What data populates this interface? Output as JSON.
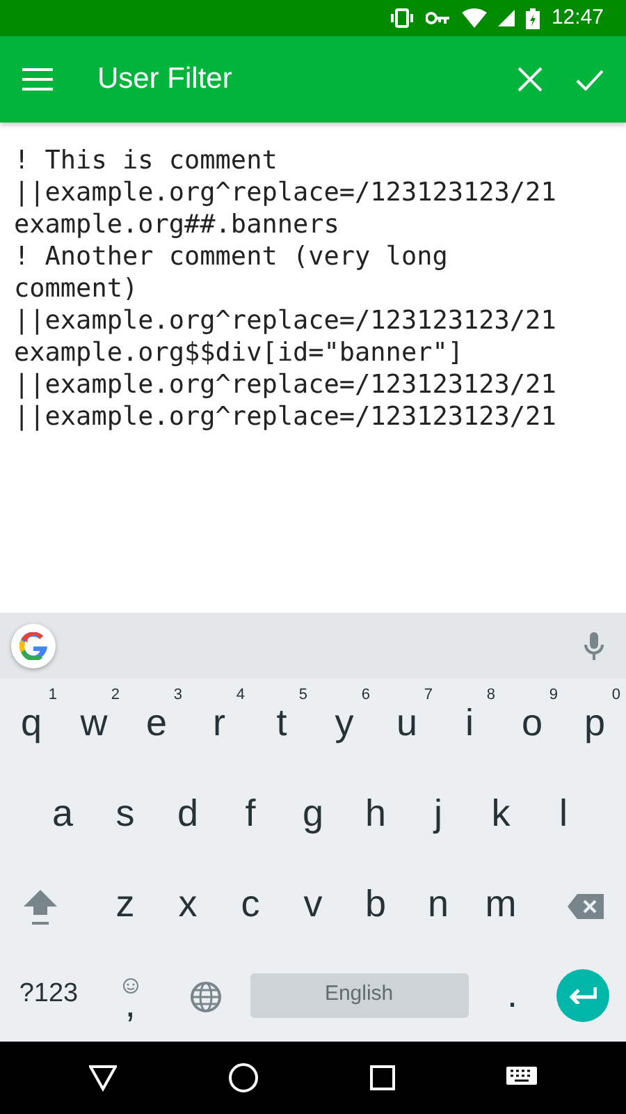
{
  "status_bar": {
    "time": "12:47"
  },
  "app_bar": {
    "title": "User Filter"
  },
  "editor": {
    "lines": [
      "! This is comment",
      "||example.org^replace=/123123123/21",
      "example.org##.banners",
      "! Another comment (very long comment)",
      "||example.org^replace=/123123123/21",
      "example.org$$div[id=\"banner\"]",
      "||example.org^replace=/123123123/21",
      "||example.org^replace=/123123123/21"
    ]
  },
  "keyboard": {
    "rows": [
      [
        {
          "label": "q",
          "hint": "1"
        },
        {
          "label": "w",
          "hint": "2"
        },
        {
          "label": "e",
          "hint": "3"
        },
        {
          "label": "r",
          "hint": "4"
        },
        {
          "label": "t",
          "hint": "5"
        },
        {
          "label": "y",
          "hint": "6"
        },
        {
          "label": "u",
          "hint": "7"
        },
        {
          "label": "i",
          "hint": "8"
        },
        {
          "label": "o",
          "hint": "9"
        },
        {
          "label": "p",
          "hint": "0"
        }
      ],
      [
        {
          "label": "a"
        },
        {
          "label": "s"
        },
        {
          "label": "d"
        },
        {
          "label": "f"
        },
        {
          "label": "g"
        },
        {
          "label": "h"
        },
        {
          "label": "j"
        },
        {
          "label": "k"
        },
        {
          "label": "l"
        }
      ],
      [
        {
          "label": "z"
        },
        {
          "label": "x"
        },
        {
          "label": "c"
        },
        {
          "label": "v"
        },
        {
          "label": "b"
        },
        {
          "label": "n"
        },
        {
          "label": "m"
        }
      ]
    ],
    "symbols_key": "?123",
    "comma_key": ",",
    "space_key": "English",
    "period_key": "."
  }
}
